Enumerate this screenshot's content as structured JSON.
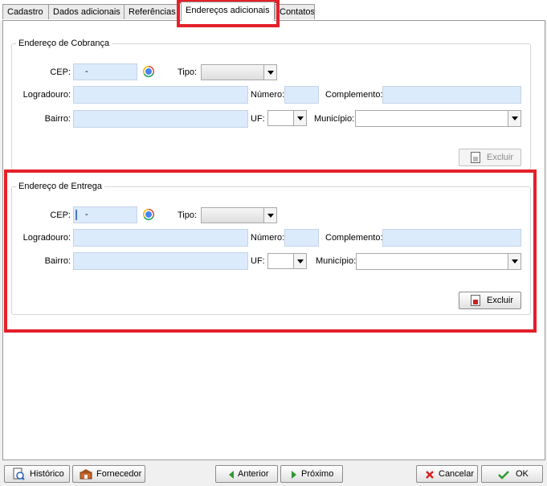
{
  "tabs": [
    {
      "label": "Cadastro"
    },
    {
      "label": "Dados adicionais"
    },
    {
      "label": "Referências"
    },
    {
      "label": "Endereços adicionais"
    },
    {
      "label": "Contatos"
    }
  ],
  "billing": {
    "title": "Endereço de Cobrança",
    "cep_label": "CEP:",
    "cep_value": "-",
    "tipo_label": "Tipo:",
    "logradouro_label": "Logradouro:",
    "numero_label": "Número:",
    "complemento_label": "Complemento:",
    "bairro_label": "Bairro:",
    "uf_label": "UF:",
    "municipio_label": "Município:",
    "delete_label": "Excluir"
  },
  "delivery": {
    "title": "Endereço de Entrega",
    "cep_label": "CEP:",
    "cep_value": "-",
    "tipo_label": "Tipo:",
    "logradouro_label": "Logradouro:",
    "numero_label": "Número:",
    "complemento_label": "Complemento:",
    "bairro_label": "Bairro:",
    "uf_label": "UF:",
    "municipio_label": "Município:",
    "delete_label": "Excluir"
  },
  "footer": {
    "history_label": "Histórico",
    "supplier_label": "Fornecedor",
    "previous_label": "Anterior",
    "next_label": "Próximo",
    "cancel_label": "Cancelar",
    "ok_label": "OK"
  },
  "colors": {
    "highlight": "#e3202a",
    "input_bg": "#dcebfc"
  },
  "icons": [
    "chrome-icon",
    "trash-icon",
    "history-icon",
    "supplier-icon",
    "arrow-left-icon",
    "arrow-right-icon",
    "cancel-x-icon",
    "check-icon"
  ]
}
